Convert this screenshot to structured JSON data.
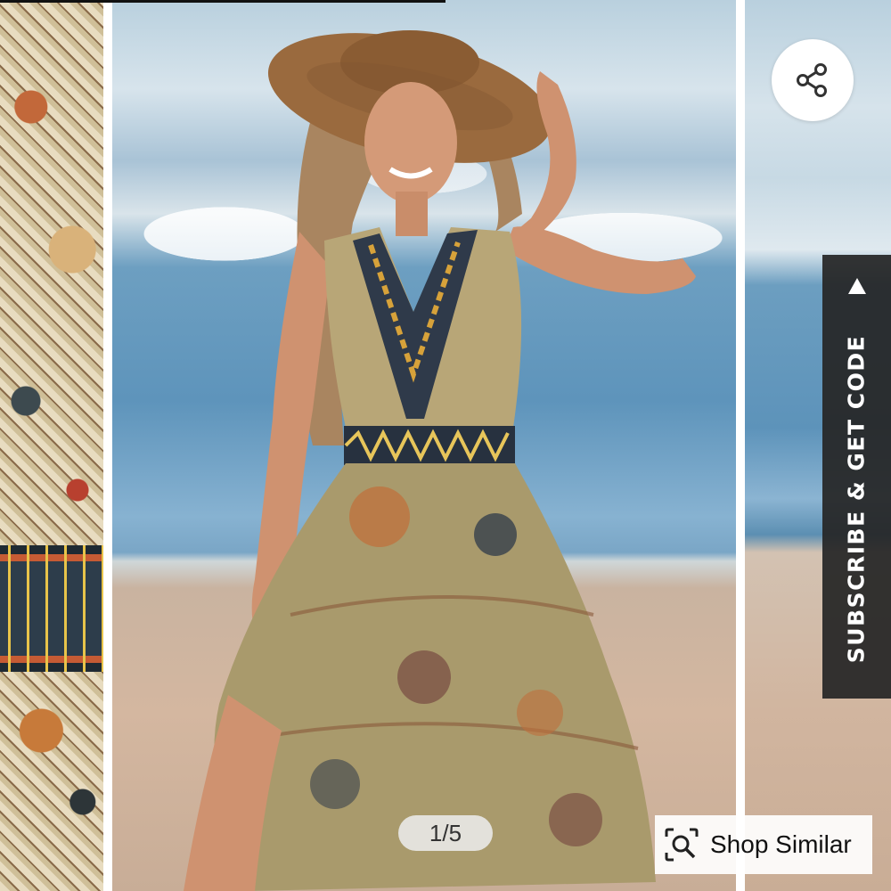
{
  "gallery": {
    "page_indicator": "1/5",
    "current_page": 1,
    "total_pages": 5
  },
  "share": {
    "icon": "share-icon"
  },
  "subscribe": {
    "label": "SUBSCRIBE & GET CODE",
    "icon": "triangle-up-icon",
    "background": "#262626"
  },
  "shop_similar": {
    "label": "Shop Similar",
    "icon": "visual-search-icon"
  },
  "colors": {
    "overlay_dark": "#262626",
    "indicator_bg": "#ebebeb",
    "text_dark": "#111111"
  }
}
